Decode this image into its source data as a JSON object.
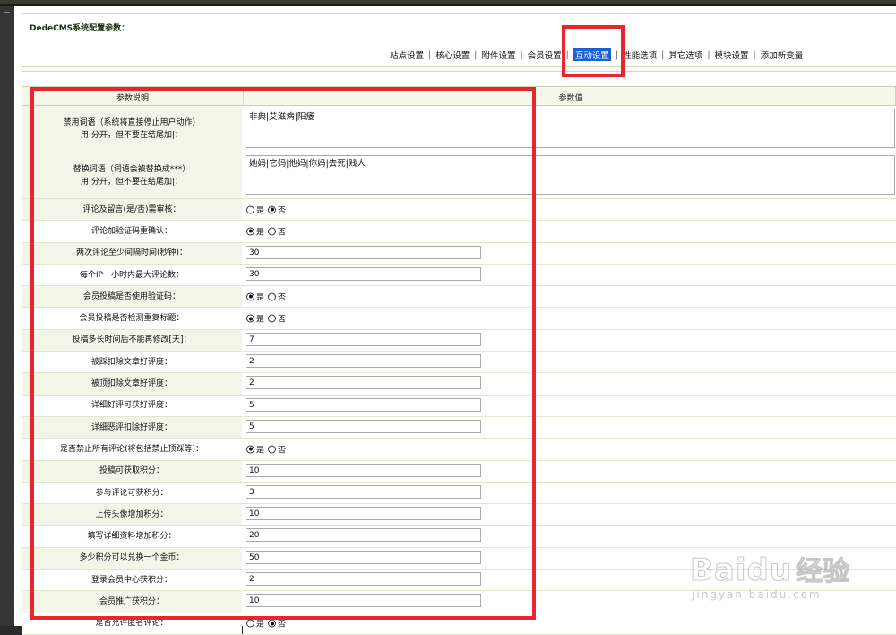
{
  "header": {
    "title": "DedeCMS系统配置参数：",
    "tabs": [
      {
        "label": "站点设置"
      },
      {
        "label": "核心设置"
      },
      {
        "label": "附件设置"
      },
      {
        "label": "会员设置"
      },
      {
        "label": "互动设置"
      },
      {
        "label": "性能选项"
      },
      {
        "label": "其它选项"
      },
      {
        "label": "模块设置"
      },
      {
        "label": "添加新变量"
      }
    ],
    "active_tab_index": 4
  },
  "grid": {
    "col_label": "参数说明",
    "col_value": "参数值",
    "rows": [
      {
        "type": "textarea",
        "label": "禁用词语（系统将直接停止用户动作）\n用|分开，但不要在结尾加|：",
        "value": "非典|艾滋病|阳痿"
      },
      {
        "type": "textarea",
        "label": "替换词语（词语会被替换成***）\n用|分开，但不要在结尾加|：",
        "value": "她妈|它妈|他妈|你妈|去死|贱人"
      },
      {
        "type": "radio",
        "label": "评论及留言(是/否)需审核：",
        "yes": "是",
        "no": "否",
        "selected": "否"
      },
      {
        "type": "radio",
        "label": "评论加验证码重确认：",
        "yes": "是",
        "no": "否",
        "selected": "是"
      },
      {
        "type": "text",
        "label": "两次评论至少间隔时间(秒钟)：",
        "value": "30"
      },
      {
        "type": "text",
        "label": "每个IP一小时内最大评论数：",
        "value": "30"
      },
      {
        "type": "radio",
        "label": "会员投稿是否使用验证码：",
        "yes": "是",
        "no": "否",
        "selected": "是"
      },
      {
        "type": "radio",
        "label": "会员投稿是否检测重复标题：",
        "yes": "是",
        "no": "否",
        "selected": "是"
      },
      {
        "type": "text",
        "label": "投稿多长时间后不能再修改[天]：",
        "value": "7"
      },
      {
        "type": "text",
        "label": "被踩扣除文章好评度：",
        "value": "2"
      },
      {
        "type": "text",
        "label": "被顶扣除文章好评度：",
        "value": "2"
      },
      {
        "type": "text",
        "label": "详细好评可获好评度：",
        "value": "5"
      },
      {
        "type": "text",
        "label": "详细恶评扣除好评度：",
        "value": "5"
      },
      {
        "type": "radio",
        "label": "是否禁止所有评论(将包括禁止顶踩等)：",
        "yes": "是",
        "no": "否",
        "selected": "是"
      },
      {
        "type": "text",
        "label": "投稿可获取积分：",
        "value": "10"
      },
      {
        "type": "text",
        "label": "参与评论可获积分：",
        "value": "3"
      },
      {
        "type": "text",
        "label": "上传头像增加积分：",
        "value": "10"
      },
      {
        "type": "text",
        "label": "填写详细资料增加积分：",
        "value": "20"
      },
      {
        "type": "text",
        "label": "多少积分可以兑换一个金币：",
        "value": "50"
      },
      {
        "type": "text",
        "label": "登录会员中心获积分：",
        "value": "2"
      },
      {
        "type": "text",
        "label": "会员推广获积分：",
        "value": "10"
      },
      {
        "type": "radio",
        "label": "是否允许匿名评论：",
        "yes": "是",
        "no": "否",
        "selected": "否"
      }
    ]
  },
  "watermark": {
    "logo": "Bai",
    "logo_tail": "du",
    "cn": "经验",
    "url": "jingyan.baidu.com"
  },
  "colors": {
    "annotation_red": "#e8262d",
    "active_tab_bg": "#1c5fd6",
    "label_bg": "#f3f5e9"
  }
}
